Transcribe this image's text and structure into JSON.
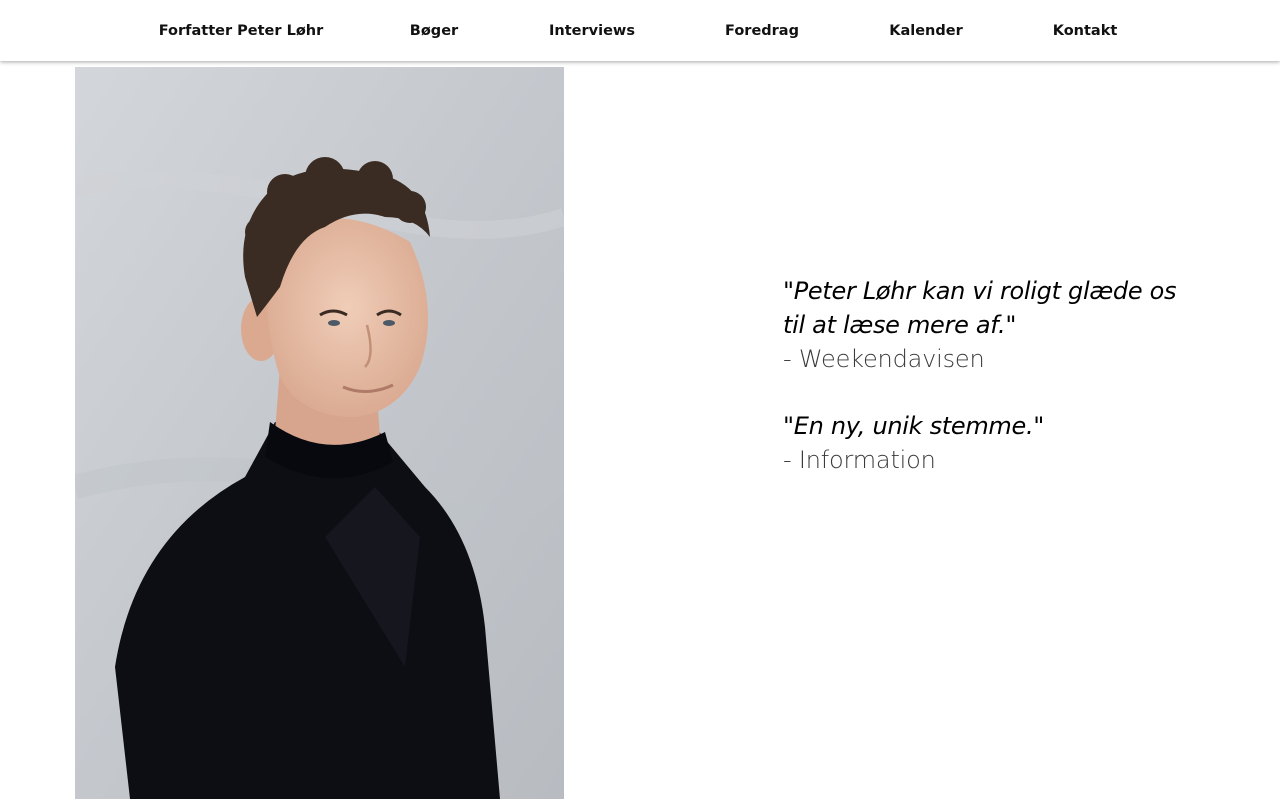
{
  "nav": {
    "items": [
      {
        "label": "Forfatter Peter Løhr"
      },
      {
        "label": "Bøger"
      },
      {
        "label": "Interviews"
      },
      {
        "label": "Foredrag"
      },
      {
        "label": "Kalender"
      },
      {
        "label": "Kontakt"
      }
    ]
  },
  "colors": {
    "background": "#ffffff",
    "text": "#111111",
    "portrait_wall": "#c9cdd2",
    "jacket": "#0d0e14",
    "skin": "#e8c3ad",
    "hair": "#3a2c22"
  },
  "reviews": [
    {
      "quote": "\"Peter Løhr kan vi roligt glæde os til at læse mere af.\"",
      "source": "- Weekendavisen"
    },
    {
      "quote": "\"En ny, unik stemme.\"",
      "source": "- Information"
    }
  ]
}
